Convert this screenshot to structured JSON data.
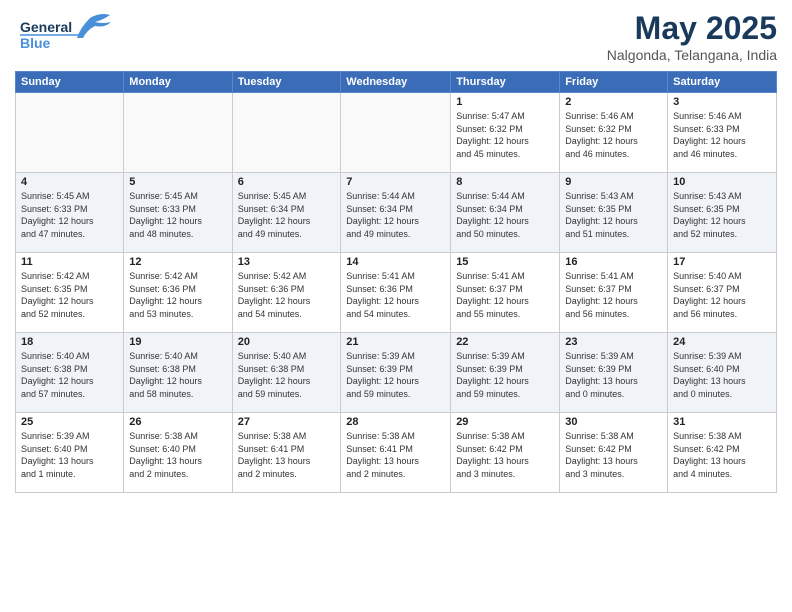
{
  "header": {
    "logo_line1": "General",
    "logo_line2": "Blue",
    "month_title": "May 2025",
    "location": "Nalgonda, Telangana, India"
  },
  "weekdays": [
    "Sunday",
    "Monday",
    "Tuesday",
    "Wednesday",
    "Thursday",
    "Friday",
    "Saturday"
  ],
  "weeks": [
    [
      {
        "day": "",
        "info": ""
      },
      {
        "day": "",
        "info": ""
      },
      {
        "day": "",
        "info": ""
      },
      {
        "day": "",
        "info": ""
      },
      {
        "day": "1",
        "info": "Sunrise: 5:47 AM\nSunset: 6:32 PM\nDaylight: 12 hours\nand 45 minutes."
      },
      {
        "day": "2",
        "info": "Sunrise: 5:46 AM\nSunset: 6:32 PM\nDaylight: 12 hours\nand 46 minutes."
      },
      {
        "day": "3",
        "info": "Sunrise: 5:46 AM\nSunset: 6:33 PM\nDaylight: 12 hours\nand 46 minutes."
      }
    ],
    [
      {
        "day": "4",
        "info": "Sunrise: 5:45 AM\nSunset: 6:33 PM\nDaylight: 12 hours\nand 47 minutes."
      },
      {
        "day": "5",
        "info": "Sunrise: 5:45 AM\nSunset: 6:33 PM\nDaylight: 12 hours\nand 48 minutes."
      },
      {
        "day": "6",
        "info": "Sunrise: 5:45 AM\nSunset: 6:34 PM\nDaylight: 12 hours\nand 49 minutes."
      },
      {
        "day": "7",
        "info": "Sunrise: 5:44 AM\nSunset: 6:34 PM\nDaylight: 12 hours\nand 49 minutes."
      },
      {
        "day": "8",
        "info": "Sunrise: 5:44 AM\nSunset: 6:34 PM\nDaylight: 12 hours\nand 50 minutes."
      },
      {
        "day": "9",
        "info": "Sunrise: 5:43 AM\nSunset: 6:35 PM\nDaylight: 12 hours\nand 51 minutes."
      },
      {
        "day": "10",
        "info": "Sunrise: 5:43 AM\nSunset: 6:35 PM\nDaylight: 12 hours\nand 52 minutes."
      }
    ],
    [
      {
        "day": "11",
        "info": "Sunrise: 5:42 AM\nSunset: 6:35 PM\nDaylight: 12 hours\nand 52 minutes."
      },
      {
        "day": "12",
        "info": "Sunrise: 5:42 AM\nSunset: 6:36 PM\nDaylight: 12 hours\nand 53 minutes."
      },
      {
        "day": "13",
        "info": "Sunrise: 5:42 AM\nSunset: 6:36 PM\nDaylight: 12 hours\nand 54 minutes."
      },
      {
        "day": "14",
        "info": "Sunrise: 5:41 AM\nSunset: 6:36 PM\nDaylight: 12 hours\nand 54 minutes."
      },
      {
        "day": "15",
        "info": "Sunrise: 5:41 AM\nSunset: 6:37 PM\nDaylight: 12 hours\nand 55 minutes."
      },
      {
        "day": "16",
        "info": "Sunrise: 5:41 AM\nSunset: 6:37 PM\nDaylight: 12 hours\nand 56 minutes."
      },
      {
        "day": "17",
        "info": "Sunrise: 5:40 AM\nSunset: 6:37 PM\nDaylight: 12 hours\nand 56 minutes."
      }
    ],
    [
      {
        "day": "18",
        "info": "Sunrise: 5:40 AM\nSunset: 6:38 PM\nDaylight: 12 hours\nand 57 minutes."
      },
      {
        "day": "19",
        "info": "Sunrise: 5:40 AM\nSunset: 6:38 PM\nDaylight: 12 hours\nand 58 minutes."
      },
      {
        "day": "20",
        "info": "Sunrise: 5:40 AM\nSunset: 6:38 PM\nDaylight: 12 hours\nand 59 minutes."
      },
      {
        "day": "21",
        "info": "Sunrise: 5:39 AM\nSunset: 6:39 PM\nDaylight: 12 hours\nand 59 minutes."
      },
      {
        "day": "22",
        "info": "Sunrise: 5:39 AM\nSunset: 6:39 PM\nDaylight: 12 hours\nand 59 minutes."
      },
      {
        "day": "23",
        "info": "Sunrise: 5:39 AM\nSunset: 6:39 PM\nDaylight: 13 hours\nand 0 minutes."
      },
      {
        "day": "24",
        "info": "Sunrise: 5:39 AM\nSunset: 6:40 PM\nDaylight: 13 hours\nand 0 minutes."
      }
    ],
    [
      {
        "day": "25",
        "info": "Sunrise: 5:39 AM\nSunset: 6:40 PM\nDaylight: 13 hours\nand 1 minute."
      },
      {
        "day": "26",
        "info": "Sunrise: 5:38 AM\nSunset: 6:40 PM\nDaylight: 13 hours\nand 2 minutes."
      },
      {
        "day": "27",
        "info": "Sunrise: 5:38 AM\nSunset: 6:41 PM\nDaylight: 13 hours\nand 2 minutes."
      },
      {
        "day": "28",
        "info": "Sunrise: 5:38 AM\nSunset: 6:41 PM\nDaylight: 13 hours\nand 2 minutes."
      },
      {
        "day": "29",
        "info": "Sunrise: 5:38 AM\nSunset: 6:42 PM\nDaylight: 13 hours\nand 3 minutes."
      },
      {
        "day": "30",
        "info": "Sunrise: 5:38 AM\nSunset: 6:42 PM\nDaylight: 13 hours\nand 3 minutes."
      },
      {
        "day": "31",
        "info": "Sunrise: 5:38 AM\nSunset: 6:42 PM\nDaylight: 13 hours\nand 4 minutes."
      }
    ]
  ]
}
